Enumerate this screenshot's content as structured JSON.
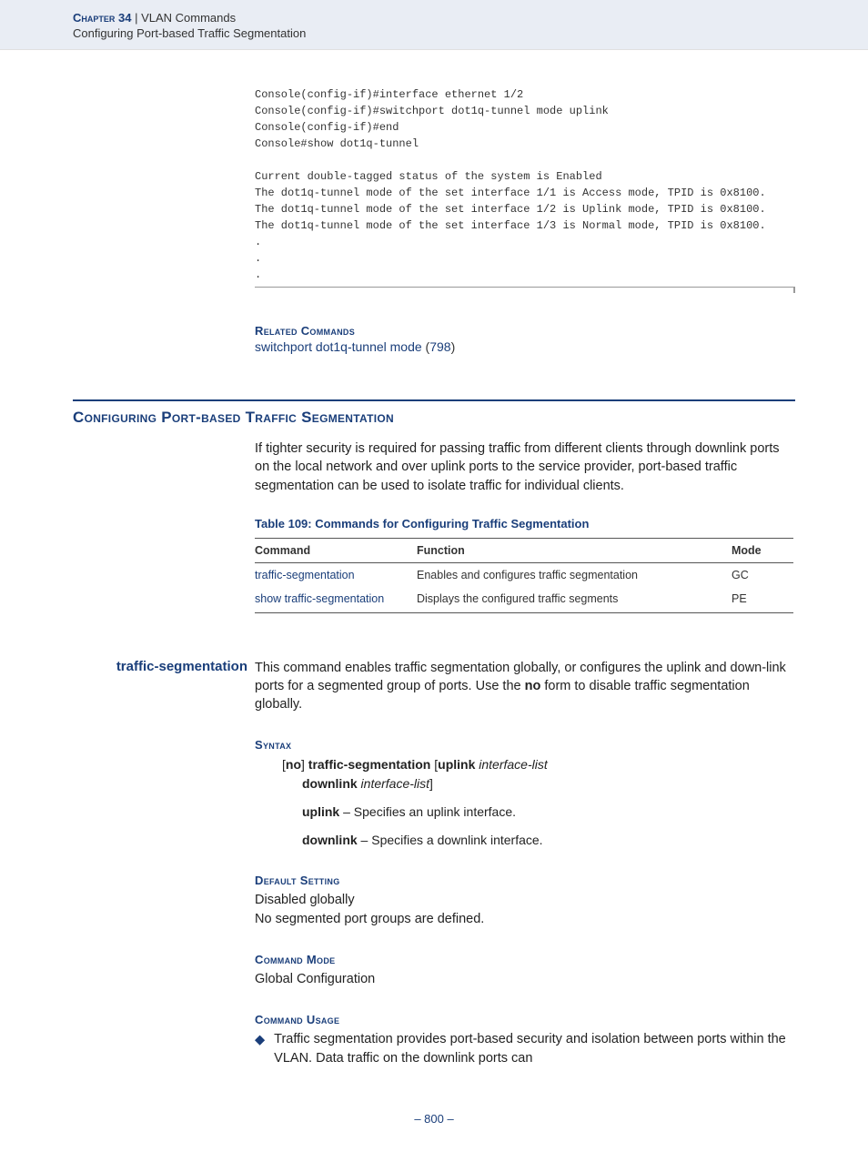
{
  "header": {
    "chapter_label": "Chapter 34",
    "separator": "  |  ",
    "chapter_title": "VLAN Commands",
    "subtitle": "Configuring Port-based Traffic Segmentation"
  },
  "code_block": "Console(config-if)#interface ethernet 1/2\nConsole(config-if)#switchport dot1q-tunnel mode uplink\nConsole(config-if)#end\nConsole#show dot1q-tunnel\n\nCurrent double-tagged status of the system is Enabled\nThe dot1q-tunnel mode of the set interface 1/1 is Access mode, TPID is 0x8100.\nThe dot1q-tunnel mode of the set interface 1/2 is Uplink mode, TPID is 0x8100.\nThe dot1q-tunnel mode of the set interface 1/3 is Normal mode, TPID is 0x8100.\n.\n.\n.",
  "related": {
    "heading": "Related Commands",
    "link_text": "switchport dot1q-tunnel mode",
    "page_ref_open": " (",
    "page_ref": "798",
    "page_ref_close": ")"
  },
  "section": {
    "title": "Configuring Port-based Traffic Segmentation",
    "intro": "If tighter security is required for passing traffic from different clients through downlink ports on the local network and over uplink ports to the service provider, port-based traffic segmentation can be used to isolate traffic for individual clients."
  },
  "table": {
    "caption": "Table 109: Commands for Configuring Traffic Segmentation",
    "headers": {
      "c1": "Command",
      "c2": "Function",
      "c3": "Mode"
    },
    "rows": [
      {
        "cmd": "traffic-segmentation",
        "func": "Enables and configures traffic segmentation",
        "mode": "GC"
      },
      {
        "cmd": "show traffic-segmentation",
        "func": "Displays the configured traffic segments",
        "mode": "PE"
      }
    ]
  },
  "command": {
    "name": "traffic-segmentation",
    "desc_pre": "This command enables traffic segmentation globally, or configures the uplink and down-link ports for a segmented group of ports. Use the ",
    "desc_bold": "no",
    "desc_post": " form to disable traffic segmentation globally."
  },
  "syntax": {
    "heading": "Syntax",
    "l1_open": "[",
    "l1_no": "no",
    "l1_mid": "] ",
    "l1_cmd": "traffic-segmentation",
    "l1_sp": " [",
    "l1_uplink": "uplink",
    "l1_il": " interface-list",
    "l2_downlink": "downlink",
    "l2_il": " interface-list",
    "l2_close": "]",
    "sub1_b": "uplink",
    "sub1_t": " – Specifies an uplink interface.",
    "sub2_b": "downlink",
    "sub2_t": " – Specifies a downlink interface."
  },
  "default_setting": {
    "heading": "Default Setting",
    "line1": "Disabled globally",
    "line2": "No segmented port groups are defined."
  },
  "command_mode": {
    "heading": "Command Mode",
    "text": "Global Configuration"
  },
  "command_usage": {
    "heading": "Command Usage",
    "bullet1": "Traffic segmentation provides port-based security and isolation between ports within the VLAN. Data traffic on the downlink ports can"
  },
  "footer": {
    "page": "–  800  –"
  }
}
